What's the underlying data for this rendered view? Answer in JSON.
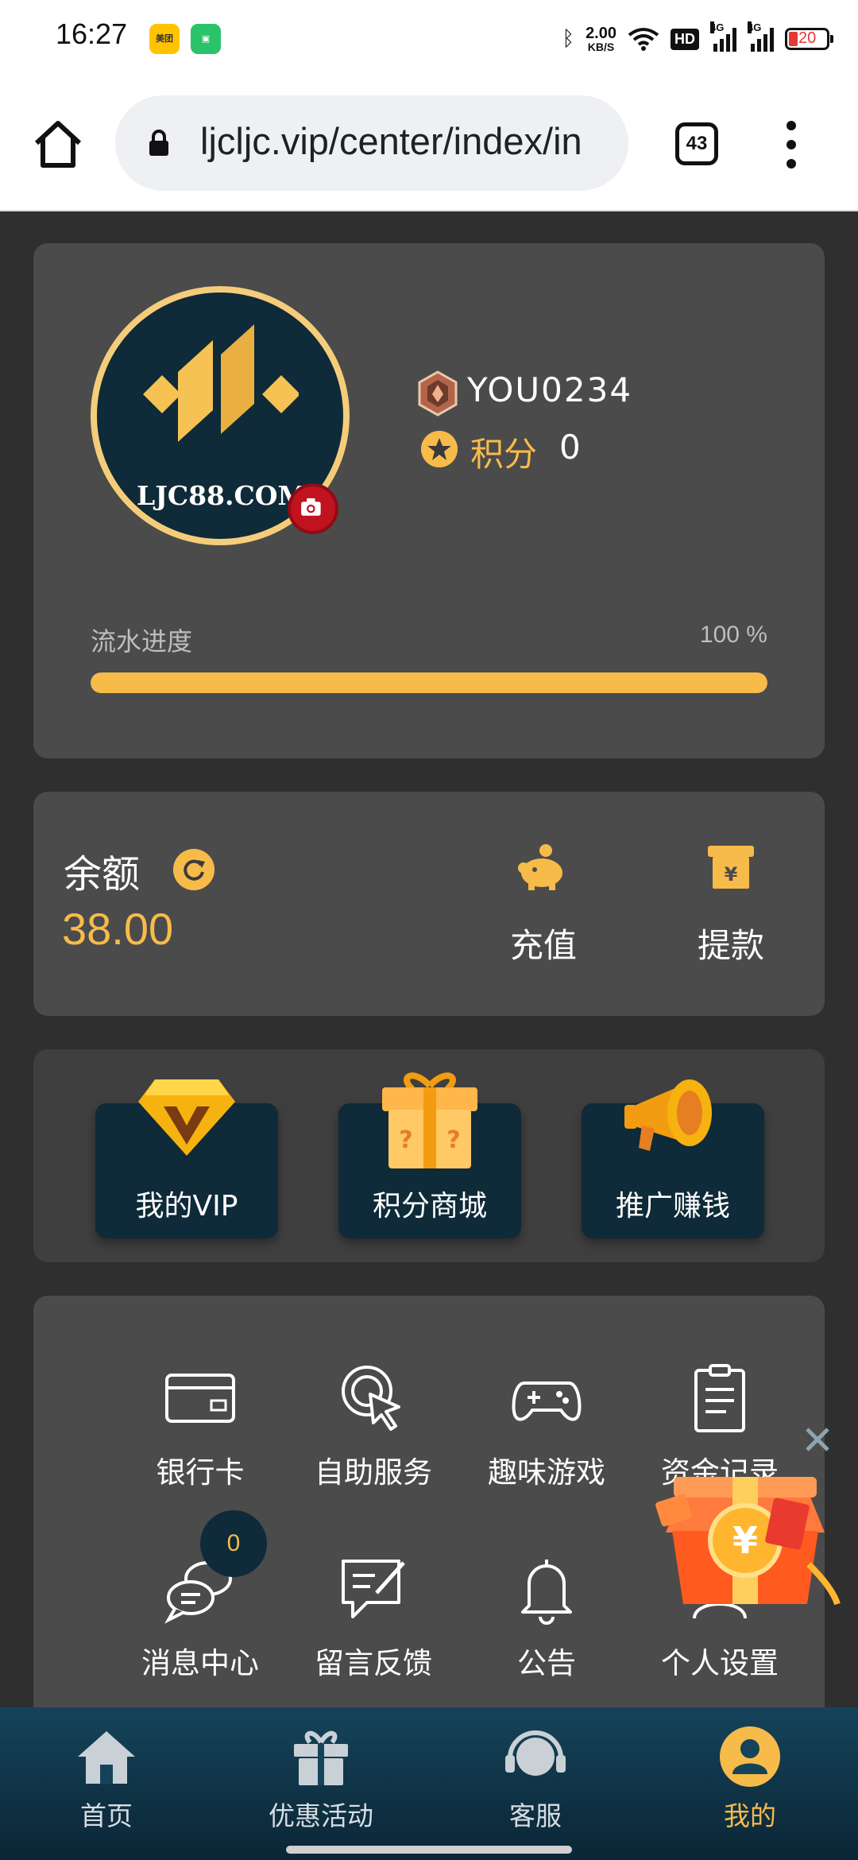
{
  "status_bar": {
    "time": "16:27",
    "app_badge_meituan": "美团",
    "net_speed_value": "2.00",
    "net_speed_unit": "KB/S",
    "hd_label": "HD",
    "signal_1_label": "4G",
    "signal_2_label": "4G",
    "battery_level": "20",
    "battery_color": "#e53935"
  },
  "browser": {
    "url": "ljcljc.vip/center/index/in",
    "tab_count": "43"
  },
  "profile": {
    "avatar_text": "LJC88.COM",
    "username": "YOU0234",
    "points_label": "积分",
    "points_value": "0",
    "progress_label": "流水进度",
    "progress_percent_text": "100 %",
    "progress_fraction": 1.0
  },
  "balance": {
    "label": "余额",
    "value": "38.00",
    "deposit_label": "充值",
    "withdraw_label": "提款"
  },
  "shortcuts": [
    {
      "label": "我的VIP",
      "icon": "vip-diamond-icon"
    },
    {
      "label": "积分商城",
      "icon": "mystery-box-icon"
    },
    {
      "label": "推广赚钱",
      "icon": "megaphone-icon"
    }
  ],
  "menu": {
    "bank_card": "银行卡",
    "self_service": "自助服务",
    "fun_games": "趣味游戏",
    "fund_records": "资金记录",
    "messages": "消息中心",
    "message_count": "0",
    "feedback": "留言反馈",
    "notice": "公告",
    "settings": "个人设置"
  },
  "bottom_nav": {
    "home": "首页",
    "promotions": "优惠活动",
    "service": "客服",
    "mine": "我的"
  },
  "colors": {
    "accent": "#f7bb4a",
    "card_bg": "#4b4b4b",
    "page_bg": "#2f2f2f",
    "nav_bg": "#15435a"
  }
}
